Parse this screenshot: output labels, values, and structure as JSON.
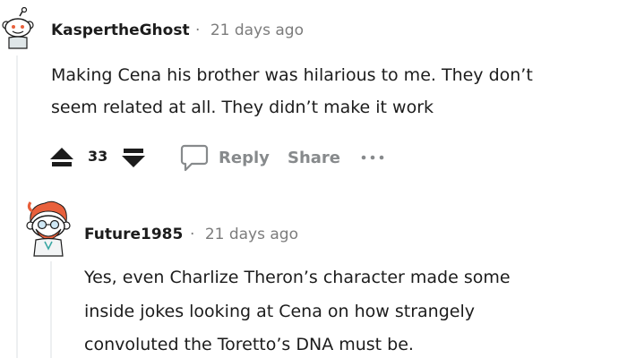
{
  "comments": [
    {
      "username": "KaspertheGhost",
      "separator": "·",
      "timestamp": "21 days ago",
      "body_lines": [
        "Making Cena his brother was hilarious to me. They don’t",
        "seem related at all. They didn’t make it work"
      ],
      "score": "33",
      "actions": {
        "reply": "Reply",
        "share": "Share",
        "more": "•••"
      }
    },
    {
      "username": "Future1985",
      "separator": "·",
      "timestamp": "21 days ago",
      "body_lines": [
        "Yes, even Charlize Theron’s character made some",
        "inside jokes looking at Cena on how strangely",
        "convoluted the Toretto’s DNA must be."
      ]
    }
  ],
  "colors": {
    "text": "#1c1c1c",
    "meta": "#7c7c7c",
    "action": "#878a8c",
    "thread_line": "#edeff1",
    "avatar2_hair": "#e8603c"
  },
  "icons": {
    "avatar_1": "snoo-avatar-icon",
    "avatar_2": "snoo-avatar-red-hair-icon",
    "upvote": "upvote-arrow-icon",
    "downvote": "downvote-arrow-icon",
    "reply": "speech-bubble-icon"
  }
}
